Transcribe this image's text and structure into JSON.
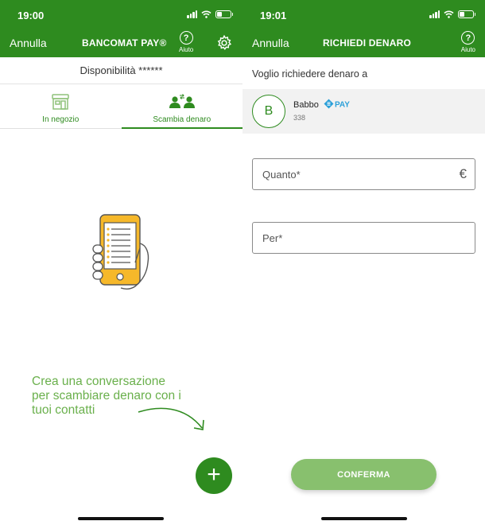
{
  "colors": {
    "brand": "#2e8b1f",
    "hint": "#6ab04c",
    "confirm": "#88c06e"
  },
  "left": {
    "status": {
      "time": "19:00"
    },
    "nav": {
      "cancel": "Annulla",
      "title": "BANCOMAT PAY®",
      "help": "Aiuto",
      "settings_icon": "gear-icon"
    },
    "balance": "Disponibilità ******",
    "tabs": [
      {
        "label": "In negozio",
        "icon": "store-icon",
        "active": false
      },
      {
        "label": "Scambia denaro",
        "icon": "people-exchange-icon",
        "active": true
      }
    ],
    "hint": "Crea una conversazione per scambiare denaro con i tuoi contatti",
    "fab": "+"
  },
  "right": {
    "status": {
      "time": "19:01"
    },
    "nav": {
      "cancel": "Annulla",
      "title": "RICHIEDI DENARO",
      "help": "Aiuto"
    },
    "request_label": "Voglio richiedere denaro a",
    "contact": {
      "initial": "B",
      "name": "Babbo",
      "phone": "338",
      "badge": "PAY"
    },
    "fields": {
      "amount_placeholder": "Quanto*",
      "currency": "€",
      "reason_placeholder": "Per*"
    },
    "confirm": "CONFERMA"
  }
}
